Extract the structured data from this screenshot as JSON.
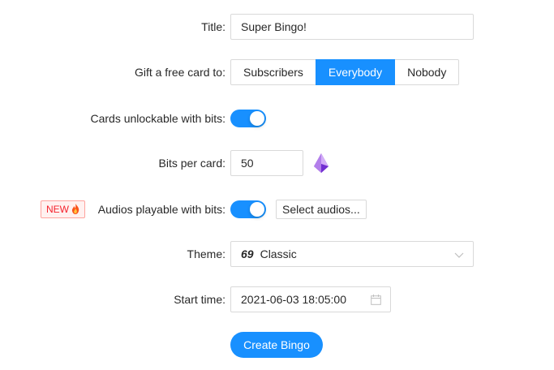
{
  "form": {
    "title": {
      "label": "Title",
      "value": "Super Bingo!"
    },
    "gift": {
      "label": "Gift a free card to",
      "options": [
        "Subscribers",
        "Everybody",
        "Nobody"
      ],
      "selected": "Everybody"
    },
    "cards_unlockable": {
      "label": "Cards unlockable with bits",
      "checked": true
    },
    "bits_per_card": {
      "label": "Bits per card",
      "value": "50",
      "icon": "bits-gem-icon"
    },
    "audios": {
      "badge": "NEW",
      "badge_icon": "fire-icon",
      "label": "Audios playable with bits",
      "checked": true,
      "button_label": "Select audios..."
    },
    "theme": {
      "label": "Theme",
      "icon_text": "69",
      "value": "Classic"
    },
    "start_time": {
      "label": "Start time",
      "value": "2021-06-03 18:05:00",
      "icon": "calendar-icon"
    },
    "submit_label": "Create Bingo"
  },
  "colors": {
    "primary": "#1890ff",
    "badge_red": "#f5222d",
    "gem_purple": "#9254de"
  }
}
